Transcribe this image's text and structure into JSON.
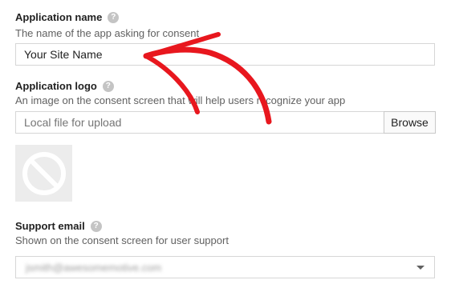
{
  "app_name_section": {
    "label": "Application name",
    "description": "The name of the app asking for consent",
    "value": "Your Site Name"
  },
  "logo_section": {
    "label": "Application logo",
    "description": "An image on the consent screen that will help users recognize your app",
    "placeholder": "Local file for upload",
    "browse_label": "Browse",
    "preview_icon": "no-image-icon"
  },
  "support_email_section": {
    "label": "Support email",
    "description": "Shown on the consent screen for user support",
    "selected_value": "jsmith@awesomemotive.com"
  },
  "colors": {
    "annotation_arrow": "#e8171e",
    "help_icon": "#c4c4c4",
    "input_border": "#d6d6d6"
  }
}
